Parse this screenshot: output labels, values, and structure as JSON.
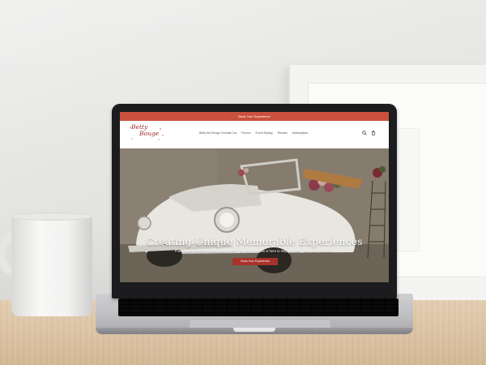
{
  "site": {
    "announcement": "Book Your Experience",
    "logo_text_1": "Betty",
    "logo_text_2": "Bouge",
    "nav": [
      "Betty the Bouge Cocktail Car",
      "Picnics",
      "Event Styling",
      "Rentals",
      "Marketplace"
    ],
    "icons": [
      "search-icon",
      "cart-icon"
    ],
    "hero": {
      "title": "Creating Unique Memorable Experiences",
      "subtitle": "From lavish picnics to extravagant events, our design house is here to help you bring your vision to reality.",
      "cta": "Book Your Experience"
    }
  },
  "colors": {
    "announcement_bar": "#c9513d",
    "brand": "#9a2c2a",
    "cta": "#a7322b"
  }
}
